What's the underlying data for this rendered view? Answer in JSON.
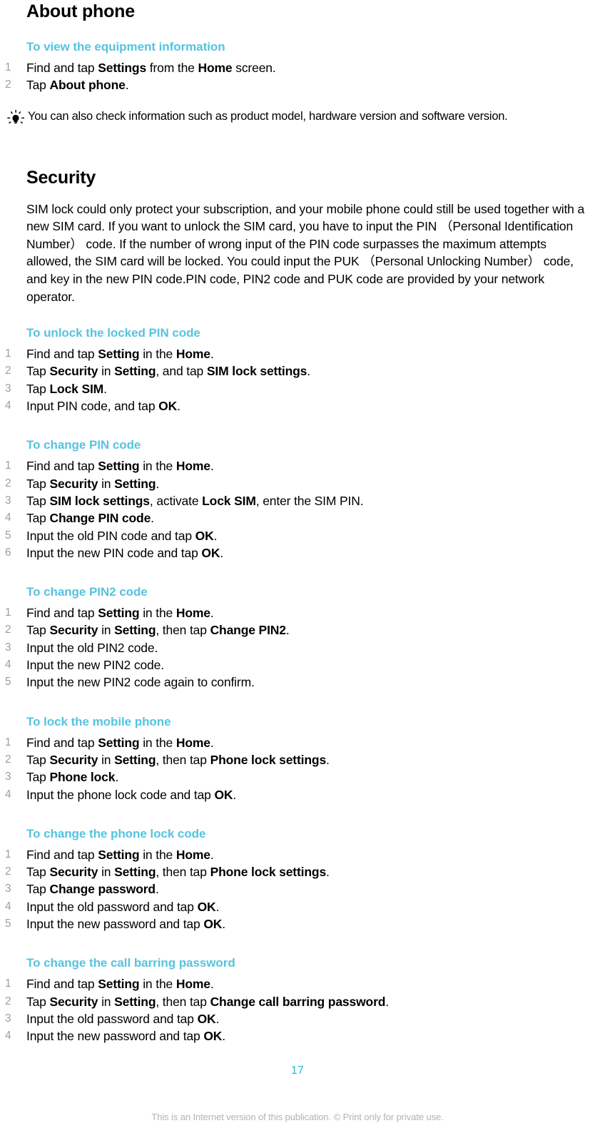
{
  "document": {
    "page_number": "17",
    "footer_note": "This is an Internet version of this publication. © Print only for private use.",
    "accent_color": "#55c3e0",
    "page_number_color": "#29b6d8",
    "step_number_color": "#9d9d9d",
    "footer_color": "#b2b2b2"
  },
  "chapter": {
    "title": "About phone"
  },
  "procedure_equipment_info": {
    "heading": "To view the equipment information",
    "steps": [
      {
        "prefix": "Find and tap ",
        "bold1": "Settings",
        "mid": " from the ",
        "bold2": "Home",
        "suffix": " screen."
      },
      {
        "prefix": "Tap ",
        "bold1": "About phone",
        "mid": "",
        "bold2": "",
        "suffix": "."
      }
    ]
  },
  "tip": {
    "icon": "lightbulb-icon",
    "text": "You can also check information such as product model, hardware version and software version."
  },
  "security_section": {
    "title": "Security",
    "body": "SIM lock could only protect your subscription, and your mobile phone could still be used together with a new SIM card. If you want to unlock the SIM card, you have to input the PIN （Personal Identification Number） code. If the number of wrong input of the PIN code surpasses the maximum attempts allowed, the SIM card will be locked. You could input the PUK （Personal Unlocking Number） code, and key in the new PIN code.PIN code, PIN2 code and PUK code are provided by your network operator."
  },
  "procedure_unlock_pin": {
    "heading": "To unlock the locked PIN code",
    "steps": [
      {
        "prefix": "Find and tap ",
        "bold1": "Setting",
        "mid": " in the ",
        "bold2": "Home",
        "suffix": "."
      },
      {
        "prefix": "Tap ",
        "bold1": "Security",
        "mid": " in ",
        "bold2": "Setting",
        "mid2": ", and tap ",
        "bold3": "SIM lock settings",
        "suffix": "."
      },
      {
        "prefix": "Tap ",
        "bold1": "Lock SIM",
        "mid": "",
        "bold2": "",
        "suffix": "."
      },
      {
        "prefix": "Input PIN code, and tap ",
        "bold1": "OK",
        "mid": "",
        "bold2": "",
        "suffix": "."
      }
    ]
  },
  "procedure_change_pin": {
    "heading": "To change PIN code",
    "steps": [
      {
        "prefix": "Find and tap ",
        "bold1": "Setting",
        "mid": " in the ",
        "bold2": "Home",
        "suffix": "."
      },
      {
        "prefix": "Tap ",
        "bold1": "Security",
        "mid": " in ",
        "bold2": "Setting",
        "suffix": "."
      },
      {
        "prefix": "Tap ",
        "bold1": "SIM lock settings",
        "mid": ", activate ",
        "bold2": "Lock SIM",
        "suffix": ", enter the SIM PIN."
      },
      {
        "prefix": "Tap ",
        "bold1": "Change PIN code",
        "mid": "",
        "bold2": "",
        "suffix": "."
      },
      {
        "prefix": "Input the old PIN code and tap ",
        "bold1": "OK",
        "mid": "",
        "bold2": "",
        "suffix": "."
      },
      {
        "prefix": "Input the new PIN code and tap ",
        "bold1": "OK",
        "mid": "",
        "bold2": "",
        "suffix": "."
      }
    ]
  },
  "procedure_change_pin2": {
    "heading": "To change PIN2 code",
    "steps": [
      {
        "prefix": "Find and tap ",
        "bold1": "Setting",
        "mid": " in the ",
        "bold2": "Home",
        "suffix": "."
      },
      {
        "prefix": "Tap ",
        "bold1": "Security",
        "mid": " in ",
        "bold2": "Setting",
        "mid2": ", then tap ",
        "bold3": "Change PIN2",
        "suffix": "."
      },
      {
        "prefix": "Input the old PIN2 code.",
        "bold1": "",
        "mid": "",
        "bold2": "",
        "suffix": ""
      },
      {
        "prefix": "Input the new PIN2 code.",
        "bold1": "",
        "mid": "",
        "bold2": "",
        "suffix": ""
      },
      {
        "prefix": "Input the new PIN2 code again to confirm.",
        "bold1": "",
        "mid": "",
        "bold2": "",
        "suffix": ""
      }
    ]
  },
  "procedure_lock_phone": {
    "heading": "To lock the mobile phone",
    "steps": [
      {
        "prefix": "Find and tap ",
        "bold1": "Setting",
        "mid": " in the ",
        "bold2": "Home",
        "suffix": "."
      },
      {
        "prefix": "Tap ",
        "bold1": "Security",
        "mid": " in ",
        "bold2": "Setting",
        "mid2": ", then tap ",
        "bold3": "Phone lock settings",
        "suffix": "."
      },
      {
        "prefix": "Tap ",
        "bold1": "Phone lock",
        "mid": "",
        "bold2": "",
        "suffix": "."
      },
      {
        "prefix": "Input the phone lock code and tap ",
        "bold1": "OK",
        "mid": "",
        "bold2": "",
        "suffix": "."
      }
    ]
  },
  "procedure_change_phone_lock": {
    "heading": "To change the phone lock code",
    "steps": [
      {
        "prefix": "Find and tap ",
        "bold1": "Setting",
        "mid": " in the ",
        "bold2": "Home",
        "suffix": "."
      },
      {
        "prefix": "Tap ",
        "bold1": "Security",
        "mid": " in ",
        "bold2": "Setting",
        "mid2": ", then tap ",
        "bold3": "Phone lock settings",
        "suffix": "."
      },
      {
        "prefix": "Tap ",
        "bold1": "Change password",
        "mid": "",
        "bold2": "",
        "suffix": "."
      },
      {
        "prefix": "Input the old password and tap ",
        "bold1": "OK",
        "mid": "",
        "bold2": "",
        "suffix": "."
      },
      {
        "prefix": "Input the new password and tap ",
        "bold1": "OK",
        "mid": "",
        "bold2": "",
        "suffix": "."
      }
    ]
  },
  "procedure_change_call_barring": {
    "heading": "To change the call barring password",
    "steps": [
      {
        "prefix": "Find and tap ",
        "bold1": "Setting",
        "mid": " in the ",
        "bold2": "Home",
        "suffix": "."
      },
      {
        "prefix": "Tap ",
        "bold1": "Security",
        "mid": " in ",
        "bold2": "Setting",
        "mid2": ", then tap ",
        "bold3": "Change call barring password",
        "suffix": "."
      },
      {
        "prefix": "Input the old password and tap ",
        "bold1": "OK",
        "mid": "",
        "bold2": "",
        "suffix": "."
      },
      {
        "prefix": "Input the new password and tap ",
        "bold1": "OK",
        "mid": "",
        "bold2": "",
        "suffix": "."
      }
    ]
  }
}
